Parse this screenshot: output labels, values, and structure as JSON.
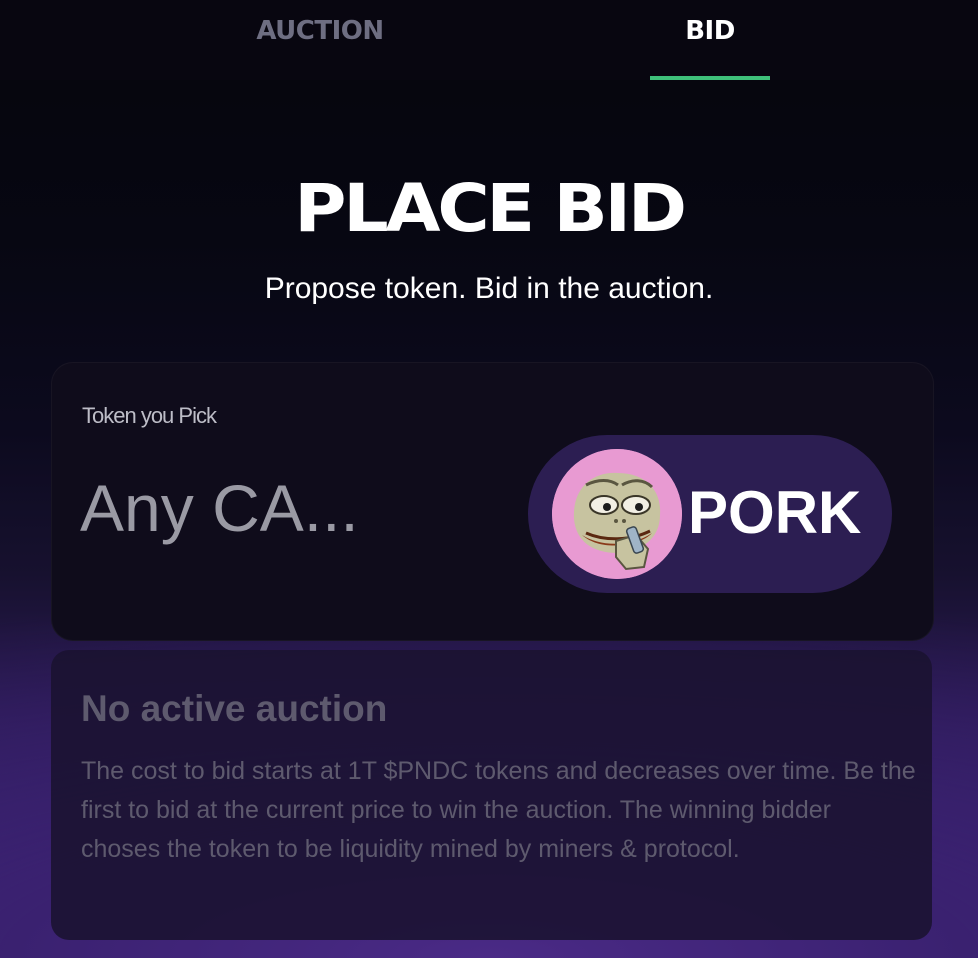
{
  "tabs": [
    {
      "label": "AUCTION",
      "active": false
    },
    {
      "label": "BID",
      "active": true
    }
  ],
  "colors": {
    "active_tab_underline": "#3fc07a",
    "token_pill": "#2c1e52",
    "token_avatar_bg": "#e89ad2"
  },
  "header": {
    "title": "PLACE BID",
    "subtitle": "Propose token. Bid in the auction."
  },
  "token_picker": {
    "label": "Token you Pick",
    "input_placeholder": "Any CA...",
    "selected_token": {
      "name": "PORK",
      "icon": "pepe-pig-avatar-icon"
    }
  },
  "auction_info": {
    "title": "No active auction",
    "body": "The cost to bid starts at 1T $PNDC tokens and decreases over time. Be the first to bid at the current price to win the auction. The winning bidder choses the token to be liquidity mined by miners & protocol."
  }
}
